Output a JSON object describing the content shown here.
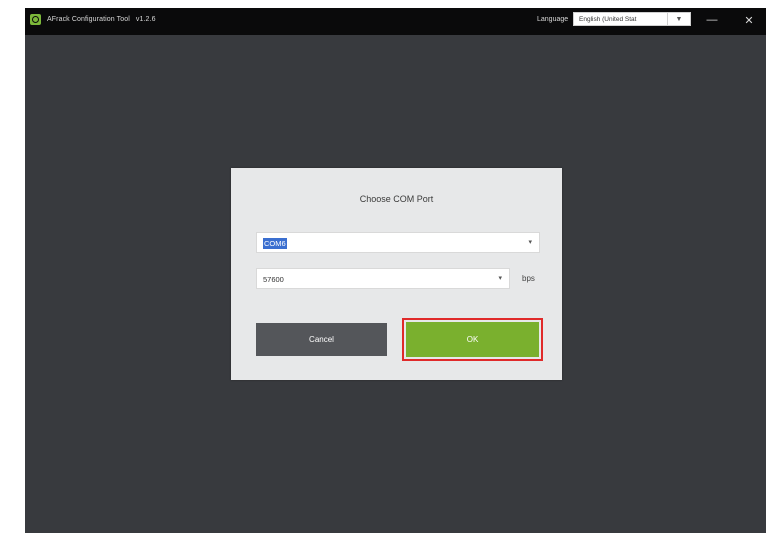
{
  "window": {
    "title": "AFrack Configuration Tool",
    "version": "v1.2.6",
    "language_label": "Language",
    "language_value": "English (United Stat",
    "language_arrow": "▼",
    "minimize_glyph": "—",
    "close_glyph": "✕"
  },
  "dialog": {
    "title": "Choose COM Port",
    "port_value": "COM6",
    "baud_value": "57600",
    "dropdown_arrow": "▾",
    "baud_unit": "bps",
    "cancel_label": "Cancel",
    "ok_label": "OK"
  },
  "colors": {
    "window_bg": "#383a3e",
    "title_bar_bg": "#0a0a0b",
    "dialog_bg": "#e7e8e9",
    "ok_button": "#7ab02e",
    "cancel_button": "#54565a",
    "highlight": "#e02a2a",
    "logo": "#7cb83a"
  },
  "icons": {
    "app_logo": "app-logo-icon",
    "minimize": "minimize-icon",
    "close": "close-icon",
    "dropdown": "chevron-down-icon"
  }
}
